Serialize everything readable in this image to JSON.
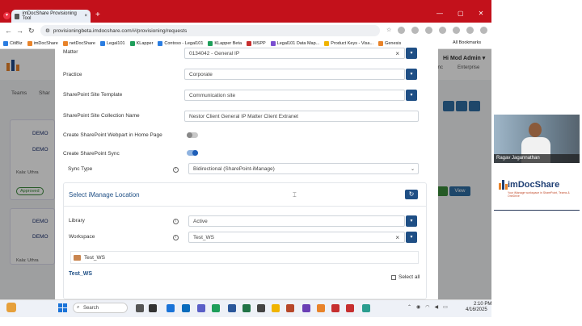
{
  "browser": {
    "tab_title": "imDocShare Provisioning Tool",
    "tab_close": "×",
    "new_tab": "+",
    "url": "provisioningbeta.imdocshare.com/#/provisioning/requests",
    "bookmarks": [
      {
        "label": "CitiBiz",
        "color": "#2a7de1"
      },
      {
        "label": "imDocShare",
        "color": "#e8832a"
      },
      {
        "label": "netDocShare",
        "color": "#e8832a"
      },
      {
        "label": "Legal101",
        "color": "#2a7de1"
      },
      {
        "label": "KLapper",
        "color": "#1e9e5a"
      },
      {
        "label": "Contoso - Legal101",
        "color": "#2a7de1"
      },
      {
        "label": "KLapper Beta",
        "color": "#1e9e5a"
      },
      {
        "label": "MSPP",
        "color": "#c62f2f"
      },
      {
        "label": "Legal101 Data Map...",
        "color": "#7b4fd1"
      },
      {
        "label": "Product Keys - Visa...",
        "color": "#f0b400"
      },
      {
        "label": "Genesis",
        "color": "#e8832a"
      }
    ],
    "all_bookmarks": "All Bookmarks"
  },
  "background_page": {
    "user": "Hi Mod Admin ▾",
    "inc": "Inc",
    "enterprise": "Enterprise",
    "teams_tab": "Teams",
    "share_tab": "Shar",
    "demo_items": [
      "DEMO",
      "DEMO",
      "DEMO",
      "DEMO"
    ],
    "kala1": "Kala: Uthra",
    "kala2": "Kala: Uthra",
    "approved": "Approved",
    "view": "View"
  },
  "modal": {
    "matter": {
      "label": "Matter",
      "value": "0134042 - General IP",
      "clear": "×"
    },
    "practice": {
      "label": "Practice",
      "value": "Corporate"
    },
    "site_template": {
      "label": "SharePoint Site Template",
      "value": "Communication site"
    },
    "site_collection": {
      "label": "SharePoint Site Collection Name",
      "value": "Nestor Client General IP Matter Client Extranet"
    },
    "webpart": {
      "label": "Create SharePoint Webpart in Home Page",
      "on": false
    },
    "sync": {
      "label": "Create SharePoint Sync",
      "on": true
    },
    "sync_type": {
      "label": "Sync Type",
      "value": "Bidirectional (SharePoint-iManage)"
    },
    "imanage": {
      "title": "Select iManage Location",
      "library": {
        "label": "Library",
        "value": "Active"
      },
      "workspace": {
        "label": "Workspace",
        "value": "Test_WS",
        "clear": "×"
      },
      "chip": "Test_WS",
      "ws_title": "Test_WS",
      "select_all": "Select all"
    }
  },
  "taskbar": {
    "search": "Search",
    "time": "2:10 PM",
    "date": "4/16/2025"
  },
  "presenter": {
    "name": "Ragav Jagannathan",
    "brand": "imDocShare",
    "tagline": "Your iManage workspace in SharePoint, Teams & OneDrive"
  },
  "colors": {
    "chrome_red": "#c3111b",
    "primary": "#1f4f85",
    "accent": "#e8832a"
  }
}
